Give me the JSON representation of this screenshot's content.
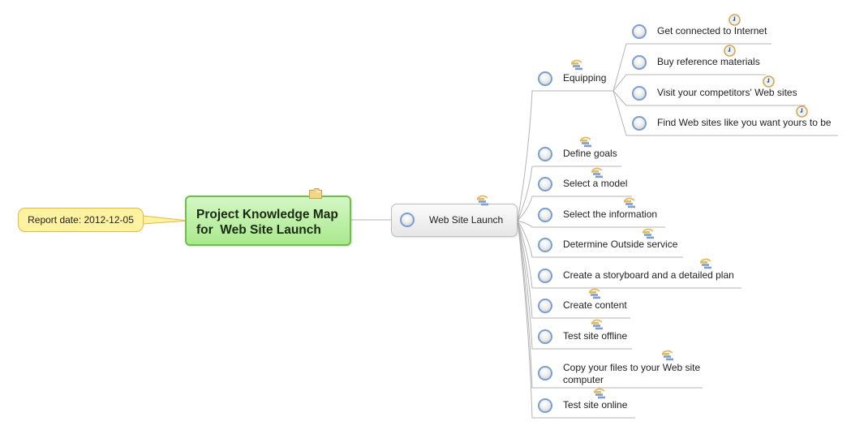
{
  "callout": {
    "text": "Report date: 2012-12-05",
    "colors": {
      "fill": "#fff2a0",
      "border": "#e8b840"
    }
  },
  "root": {
    "title": "Project Knowledge Map\nfor  Web Site Launch",
    "icon": "folder-icon",
    "colors": {
      "fill": "#b9ef9f",
      "border": "#6cc048"
    }
  },
  "main": {
    "label": "Web Site Launch",
    "icon": "task-tree-icon"
  },
  "topics": [
    {
      "label": "Equipping",
      "icon": "task-tree-icon",
      "children": [
        {
          "label": "Get connected to Internet",
          "icon": "clock-icon"
        },
        {
          "label": "Buy reference materials",
          "icon": "clock-icon"
        },
        {
          "label": "Visit your competitors' Web sites",
          "icon": "clock-icon"
        },
        {
          "label": "Find Web sites like you want yours to be",
          "icon": "clock-icon"
        }
      ]
    },
    {
      "label": "Define goals",
      "icon": "task-tree-icon"
    },
    {
      "label": "Select a model",
      "icon": "task-tree-icon"
    },
    {
      "label": "Select the information",
      "icon": "task-tree-icon"
    },
    {
      "label": "Determine Outside service",
      "icon": "task-tree-icon"
    },
    {
      "label": "Create a storyboard and a detailed plan",
      "icon": "task-tree-icon"
    },
    {
      "label": "Create content",
      "icon": "task-tree-icon"
    },
    {
      "label": "Test site offline",
      "icon": "task-tree-icon"
    },
    {
      "label": "Copy your files to your Web site computer",
      "icon": "task-tree-icon"
    },
    {
      "label": "Test site online",
      "icon": "task-tree-icon"
    }
  ],
  "colors": {
    "bullet_ring": "#7a9fd0",
    "connector": "#b4b4b4",
    "clock_ring": "#d6a64a",
    "tree_top": "#e4b85c",
    "tree_bars": "#7f9fca"
  }
}
